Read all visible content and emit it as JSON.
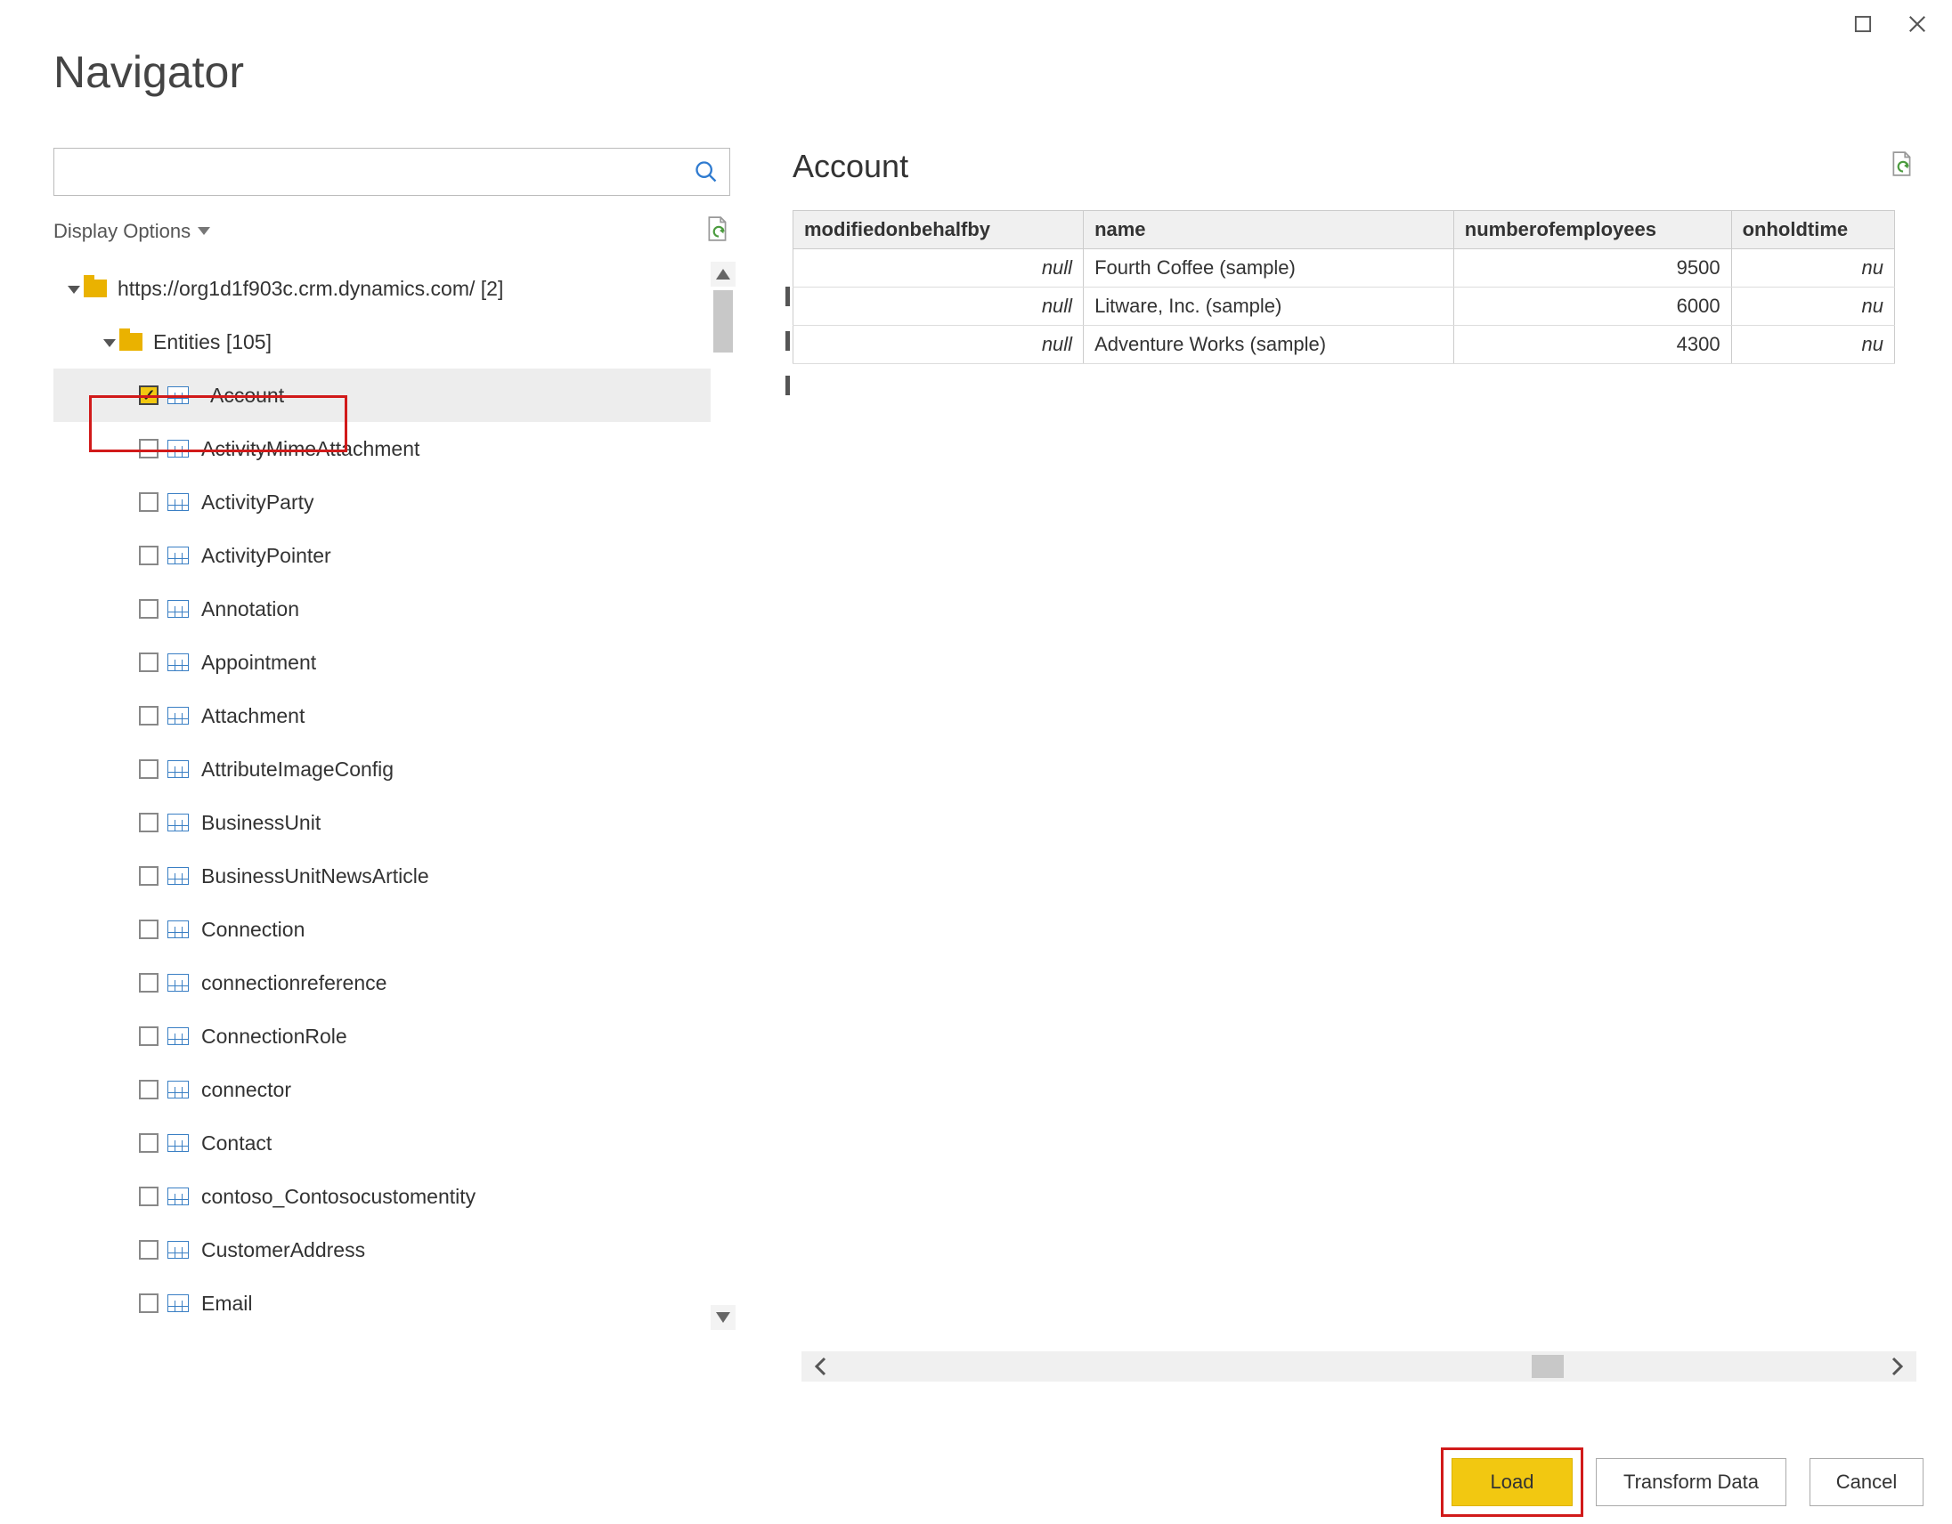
{
  "title": "Navigator",
  "displayOptionsLabel": "Display Options",
  "tree": {
    "rootLabel": "https://org1d1f903c.crm.dynamics.com/ [2]",
    "entitiesLabel": "Entities [105]",
    "items": [
      {
        "label": "Account",
        "checked": true,
        "selected": true
      },
      {
        "label": "ActivityMimeAttachment",
        "checked": false
      },
      {
        "label": "ActivityParty",
        "checked": false
      },
      {
        "label": "ActivityPointer",
        "checked": false
      },
      {
        "label": "Annotation",
        "checked": false
      },
      {
        "label": "Appointment",
        "checked": false
      },
      {
        "label": "Attachment",
        "checked": false
      },
      {
        "label": "AttributeImageConfig",
        "checked": false
      },
      {
        "label": "BusinessUnit",
        "checked": false
      },
      {
        "label": "BusinessUnitNewsArticle",
        "checked": false
      },
      {
        "label": "Connection",
        "checked": false
      },
      {
        "label": "connectionreference",
        "checked": false
      },
      {
        "label": "ConnectionRole",
        "checked": false
      },
      {
        "label": "connector",
        "checked": false
      },
      {
        "label": "Contact",
        "checked": false
      },
      {
        "label": "contoso_Contosocustomentity",
        "checked": false
      },
      {
        "label": "CustomerAddress",
        "checked": false
      },
      {
        "label": "Email",
        "checked": false
      }
    ]
  },
  "preview": {
    "title": "Account",
    "columns": [
      "modifiedonbehalfby",
      "name",
      "numberofemployees",
      "onholdtime"
    ],
    "rows": [
      {
        "modifiedonbehalfby": "null",
        "name": "Fourth Coffee (sample)",
        "numberofemployees": "9500",
        "onholdtime": "nu"
      },
      {
        "modifiedonbehalfby": "null",
        "name": "Litware, Inc. (sample)",
        "numberofemployees": "6000",
        "onholdtime": "nu"
      },
      {
        "modifiedonbehalfby": "null",
        "name": "Adventure Works (sample)",
        "numberofemployees": "4300",
        "onholdtime": "nu"
      }
    ]
  },
  "buttons": {
    "load": "Load",
    "transform": "Transform Data",
    "cancel": "Cancel"
  }
}
